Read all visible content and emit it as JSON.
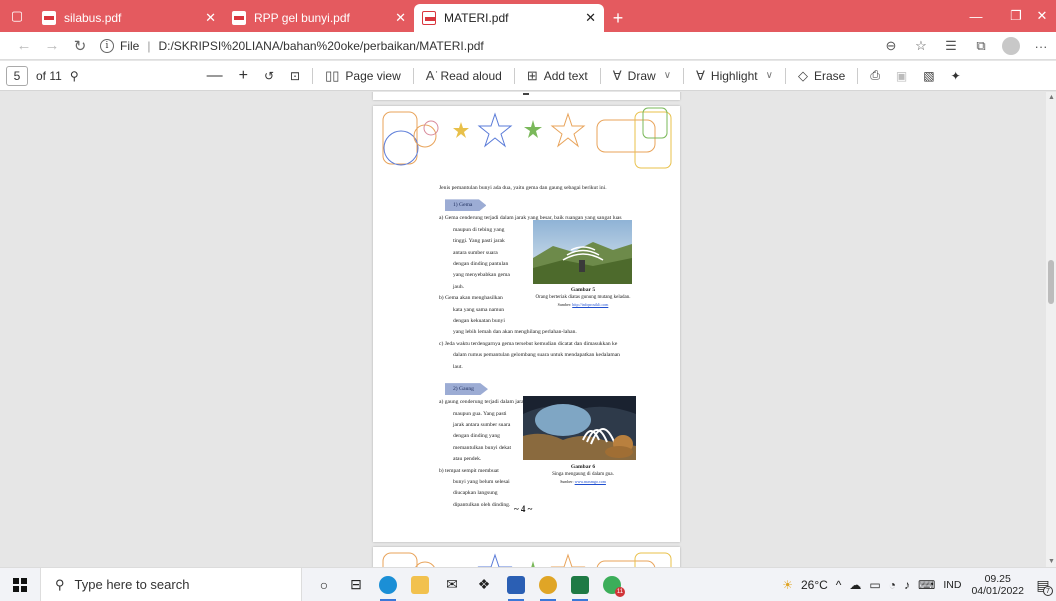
{
  "browser": {
    "tabs": [
      {
        "title": "silabus.pdf",
        "active": false
      },
      {
        "title": "RPP gel bunyi.pdf",
        "active": false
      },
      {
        "title": "MATERI.pdf",
        "active": true
      }
    ],
    "accent": "#e45a5f",
    "url_prefix": "File",
    "url": "D:/SKRIPSI%20LIANA/bahan%20oke/perbaikan/MATERI.pdf"
  },
  "pdf_toolbar": {
    "page_number": "5",
    "page_total": "of 11",
    "page_view": "Page view",
    "read_aloud": "Read aloud",
    "add_text": "Add text",
    "draw": "Draw",
    "highlight": "Highlight",
    "erase": "Erase"
  },
  "document": {
    "intro": "Jenis pemantulan bunyi ada dua, yaitu gema dan gaung sebagai berikut ini.",
    "section1": {
      "heading": "1)  Gema",
      "a_first": "a)  Gema cenderung terjadi dalam jarak yang besar, baik ruangan yang sangat luas",
      "a_rest": [
        "maupun di tebing yang",
        "tinggi. Yang pasti jarak",
        "antara sumber suara",
        "dengan dinding pantulan",
        "yang menyebabkan gema",
        "jauh."
      ],
      "b_lines": [
        "b)  Gema akan menghasilkan",
        "kata yang sama namun",
        "dengan kekuatan bunyi"
      ],
      "b_last": "yang lebih lemah dan akan menghilang perlahan-lahan.",
      "c_first": "c)  Jeda waktu terdengarnya gema tersebut kemudian dicatat dan dimasukkan ke",
      "c_rest": [
        "dalam rumus pemantulan gelombang suara untuk mendapatkan kedalaman",
        "laut."
      ],
      "figure_title": "Gambar 5",
      "figure_caption": "Orang berteriak diatas gunung mutang keladan.",
      "figure_source_label": "Sumber:",
      "figure_source": "http://infoprosikli.com"
    },
    "section2": {
      "heading": "2)  Gaung",
      "a_first": "a)  gaung cenderung terjadi dalam jarak yang kecil, misalnya di ruangan sempit",
      "a_rest": [
        "maupun gua. Yang pasti",
        "jarak antara sumber suara",
        "dengan dinding yang",
        "memantulkan bunyi dekat",
        "atau pendek."
      ],
      "b_lines": [
        "b)  tempat sempit membuat",
        "bunyi yang belum selesai",
        "diucapkan langsung",
        "dipantulkan oleh dinding."
      ],
      "figure_title": "Gambar 6",
      "figure_caption": "Singa mengaung di dalam gua.",
      "figure_source_label": "Sumber:",
      "figure_source": "www.maxmgo.com"
    },
    "page_label": "~ 4 ~"
  },
  "taskbar": {
    "search_placeholder": "Type here to search",
    "weather": "26°C",
    "language": "IND",
    "time": "09.25",
    "date": "04/01/2022",
    "mail_badge": "11",
    "notification_count": "7"
  }
}
